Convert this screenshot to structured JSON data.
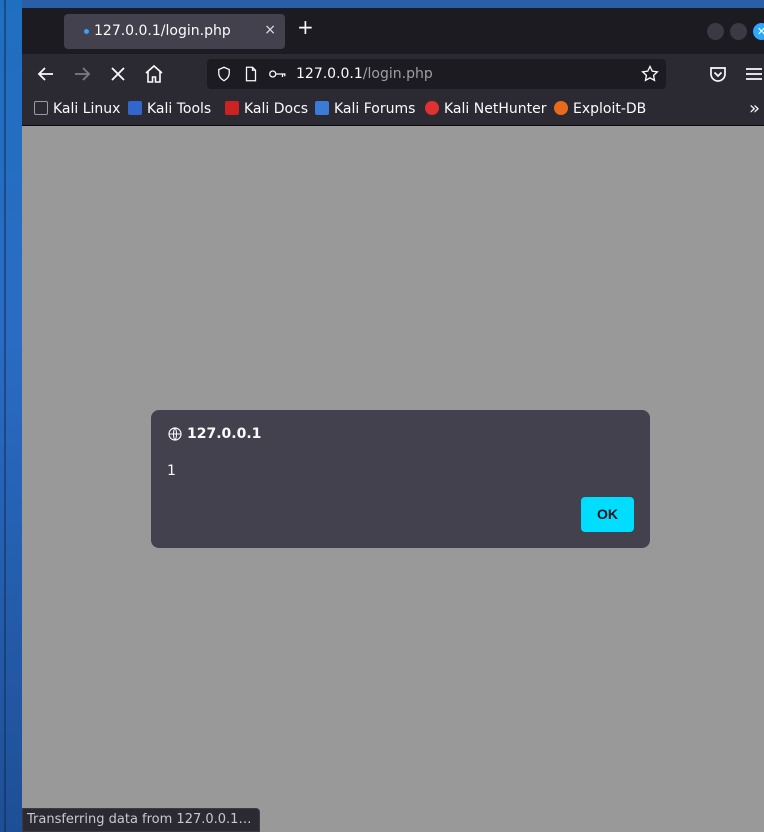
{
  "tab": {
    "title": "127.0.0.1/login.php",
    "close": "×"
  },
  "new_tab": "+",
  "url": {
    "host": "127.0.0.1",
    "path": "/login.php"
  },
  "bookmarks": [
    {
      "label": "Kali Linux",
      "icon": "kali-dragon-icon",
      "color": "#2b2a33"
    },
    {
      "label": "Kali Tools",
      "icon": "kali-tools-icon",
      "color": "#3366cc"
    },
    {
      "label": "Kali Docs",
      "icon": "kali-docs-icon",
      "color": "#cc2222"
    },
    {
      "label": "Kali Forums",
      "icon": "kali-forums-icon",
      "color": "#3a7bd5"
    },
    {
      "label": "Kali NetHunter",
      "icon": "nethunter-icon",
      "color": "#e03030"
    },
    {
      "label": "Exploit-DB",
      "icon": "exploit-db-icon",
      "color": "#e86a1c"
    }
  ],
  "overflow": "»",
  "dialog": {
    "origin": "127.0.0.1",
    "message": "1",
    "ok_label": "OK"
  },
  "status": "Transferring data from 127.0.0.1…",
  "colors": {
    "accent": "#00ddff",
    "content_bg": "#999999",
    "chrome_bg": "#2b2a33"
  }
}
